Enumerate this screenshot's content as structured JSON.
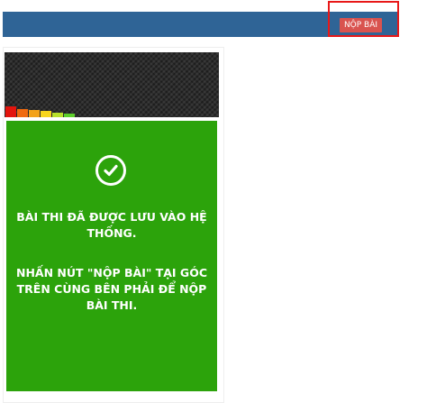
{
  "header": {
    "submit_label": "NỘP BÀI"
  },
  "card": {
    "saved_message": "BÀI THI ĐÃ ĐƯỢC LƯU VÀO HỆ THỐNG.",
    "instruction": "NHẤN NÚT \"NỘP BÀI\" TẠI GÓC TRÊN CÙNG BÊN PHẢI ĐỂ NỘP BÀI THI."
  },
  "colors": {
    "header_bg": "#2f6496",
    "submit_button": "#d9534f",
    "highlight_border": "#e81818",
    "card_green": "#2ca30b"
  },
  "icons": {
    "status": "check-circle-icon"
  }
}
